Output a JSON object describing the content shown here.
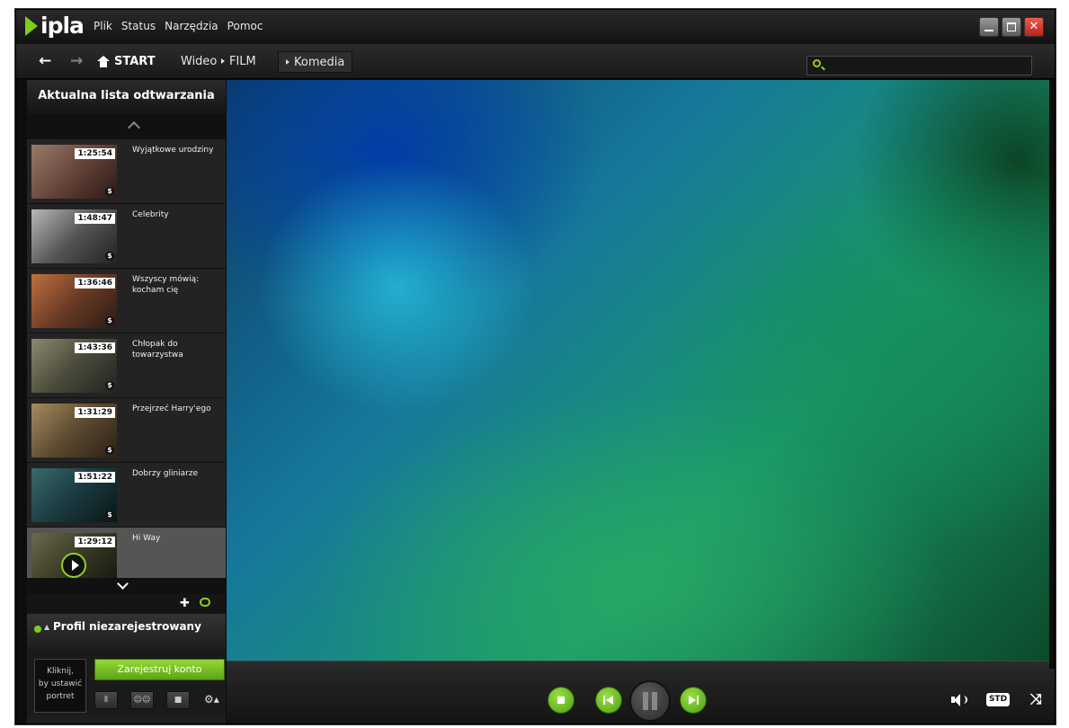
{
  "app": {
    "logo": "ipla"
  },
  "menu": [
    "Plik",
    "Status",
    "Narzędzia",
    "Pomoc"
  ],
  "window": {
    "close_glyph": "✕"
  },
  "breadcrumb": {
    "home": "START",
    "items": [
      "Wideo",
      "FILM",
      "Komedia"
    ]
  },
  "search": {
    "value": "",
    "placeholder": ""
  },
  "sidebar": {
    "title": "Aktualna lista odtwarzania",
    "items": [
      {
        "duration": "1:25:54",
        "title": "Wyjątkowe urodziny",
        "paid": "$"
      },
      {
        "duration": "1:48:47",
        "title": "Celebrity",
        "paid": "$"
      },
      {
        "duration": "1:36:46",
        "title": "Wszyscy mówią: kocham cię",
        "paid": "$"
      },
      {
        "duration": "1:43:36",
        "title": "Chłopak do towarzystwa",
        "paid": "$"
      },
      {
        "duration": "1:31:29",
        "title": "Przejrzeć Harry'ego",
        "paid": "$"
      },
      {
        "duration": "1:51:22",
        "title": "Dobrzy gliniarze",
        "paid": "$"
      },
      {
        "duration": "1:29:12",
        "title": "Hi Way",
        "paid": ""
      }
    ]
  },
  "profile": {
    "name": "Profil niezarejestrowany",
    "portrait_hint_l1": "Kliknij,",
    "portrait_hint_l2": "by ustawić",
    "portrait_hint_l3": "portret",
    "register_label": "Zarejestruj konto"
  },
  "player": {
    "quality_label": "STD"
  },
  "icons": [
    "back-arrow-icon",
    "forward-arrow-icon",
    "home-icon",
    "search-icon",
    "shuffle-icon",
    "repeat-icon",
    "rss-icon",
    "friends-icon",
    "chat-icon",
    "gear-icon",
    "stop-icon",
    "previous-icon",
    "pause-icon",
    "next-icon",
    "volume-icon",
    "fullscreen-icon"
  ],
  "colors": {
    "accent": "#7fcc1d",
    "close": "#d33a2c"
  }
}
